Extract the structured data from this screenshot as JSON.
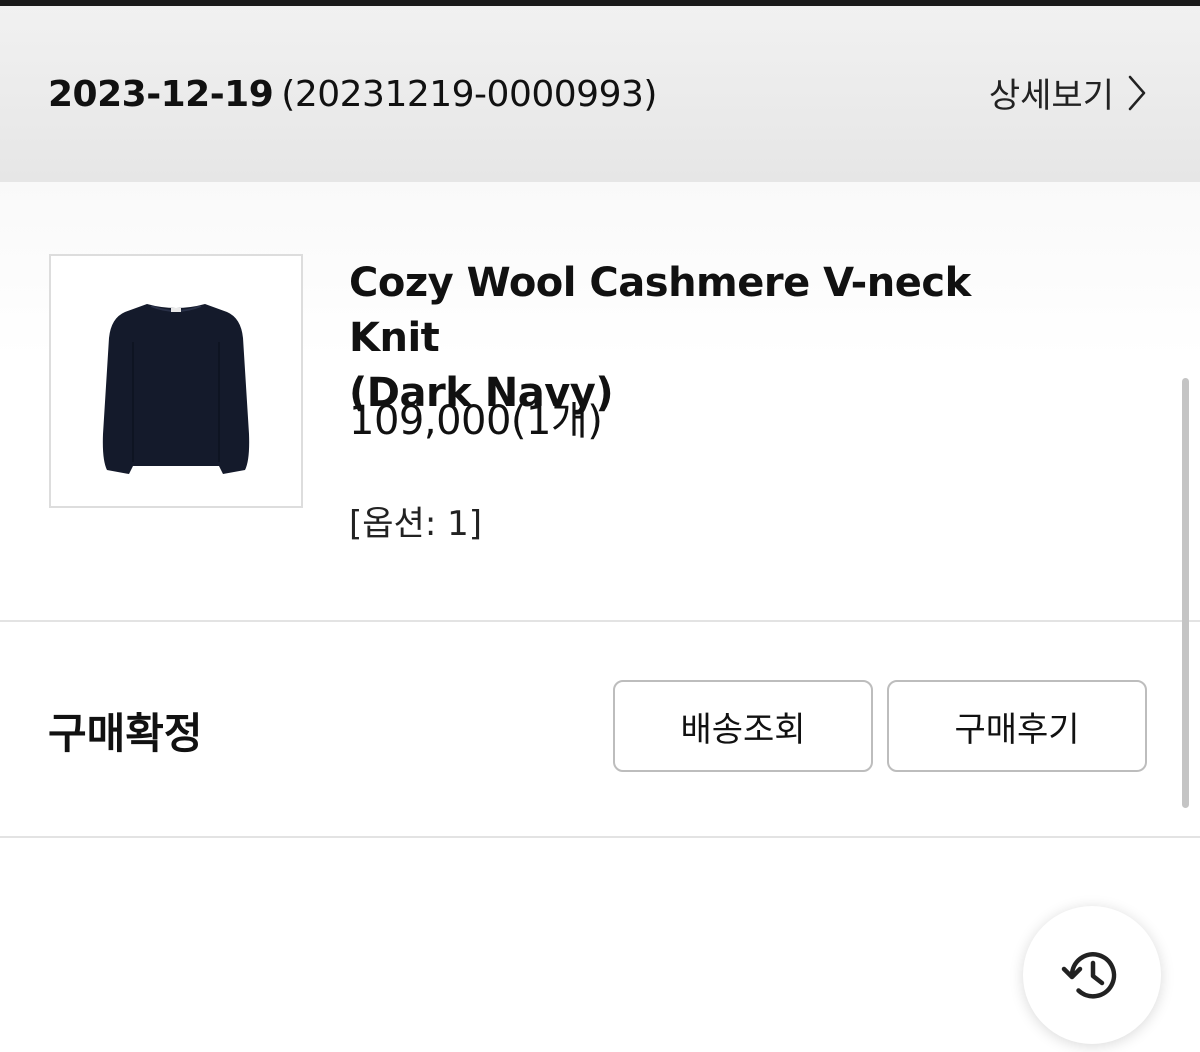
{
  "order": {
    "date": "2023-12-19",
    "number": "(20231219-0000993)",
    "detail_label": "상세보기"
  },
  "product": {
    "name_line1": "Cozy Wool Cashmere V-neck Knit",
    "name_line2": "(Dark Navy)",
    "price": "109,000(1개)",
    "option": "[옵션: 1]",
    "image_icon": "sweater-image",
    "sweater_color": "#141a2b"
  },
  "status": {
    "label": "구매확정"
  },
  "actions": {
    "tracking_label": "배송조회",
    "review_label": "구매후기"
  },
  "fab": {
    "icon": "history-icon"
  }
}
